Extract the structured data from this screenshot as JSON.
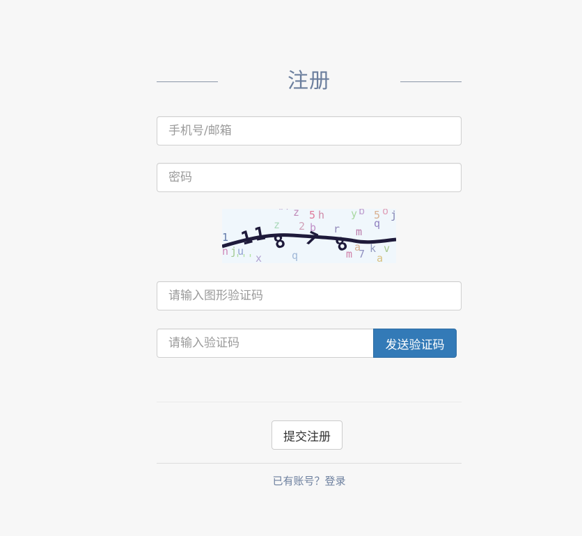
{
  "header": {
    "title": "注册"
  },
  "form": {
    "account_placeholder": "手机号/邮箱",
    "password_placeholder": "密码",
    "captcha_placeholder": "请输入图形验证码",
    "sms_placeholder": "请输入验证码",
    "send_code_label": "发送验证码",
    "submit_label": "提交注册"
  },
  "captcha_image": {
    "glyphs": [
      "1",
      "1",
      "8",
      "7",
      "8",
      "z",
      "5",
      "h",
      "y",
      "b",
      "5",
      "o",
      "j",
      "r",
      "m",
      "q",
      "k",
      "v",
      "a",
      "n",
      "j",
      "u",
      "x",
      "q",
      "7",
      "m",
      "l"
    ]
  },
  "footer": {
    "have_account_text": "已有账号？",
    "login_link": "登录"
  },
  "colors": {
    "background": "#f7f7f7",
    "title": "#6c7f9e",
    "primary_button": "#337ab7",
    "link": "#6c7f9e"
  }
}
